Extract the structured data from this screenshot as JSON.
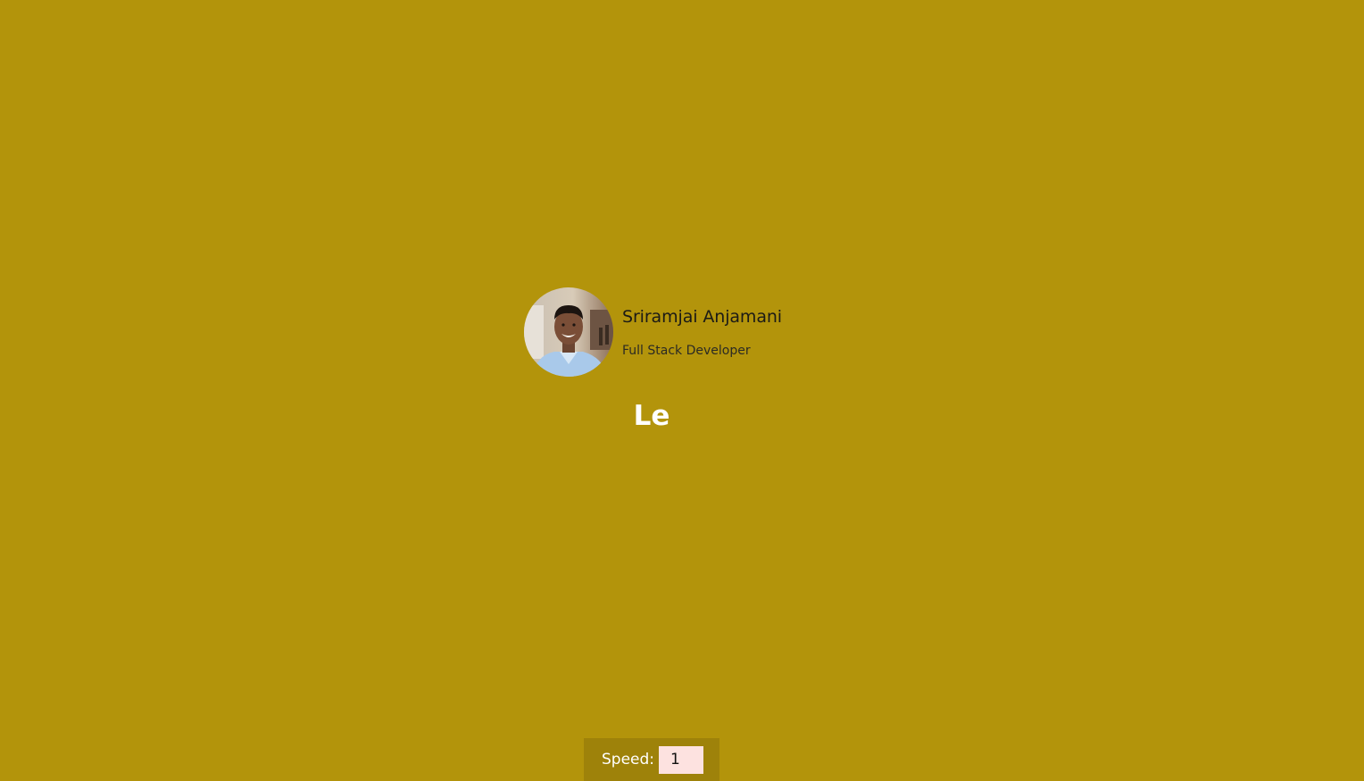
{
  "profile": {
    "name": "Sriramjai Anjamani",
    "role": "Full Stack Developer",
    "avatar_icon": "profile-photo"
  },
  "typed": {
    "text": "Le"
  },
  "controls": {
    "speed_label": "Speed:",
    "speed_value": "1"
  },
  "colors": {
    "background": "#b3940b",
    "controls_background": "#9e820a",
    "input_background": "#fde2e0",
    "text_dark": "#1b1a16",
    "text_light": "#ffffff"
  }
}
